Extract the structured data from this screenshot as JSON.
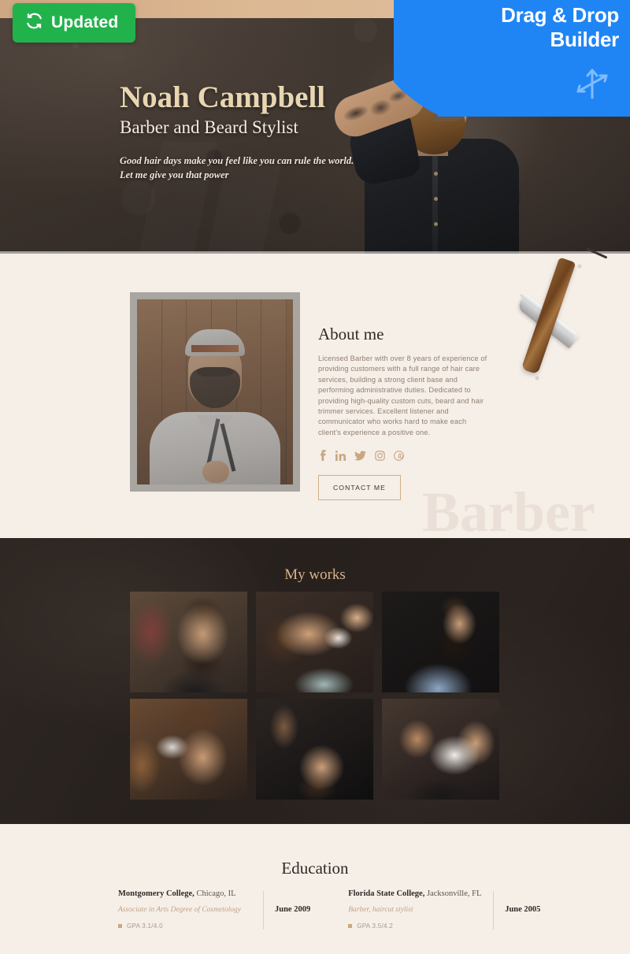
{
  "badges": {
    "updated_label": "Updated",
    "updated_icon": "refresh-sync-icon",
    "updated_color": "#22b24c",
    "ribbon_line1": "Drag & Drop",
    "ribbon_line2": "Builder",
    "ribbon_icon": "move-arrows-icon",
    "ribbon_color": "#1f85f5"
  },
  "hero": {
    "name": "Noah Campbell",
    "subtitle": "Barber and Beard Stylist",
    "tagline": "Good hair days make you feel like you can rule the world. Let me give you that power",
    "name_color": "#e8d6b2"
  },
  "about": {
    "watermark": "Barber",
    "title": "About me",
    "body": "Licensed Barber with over 8 years of experience of providing customers with a full range of hair care services, building a strong client base and performing administrative duties. Dedicated to providing  high-quality custom cuts, beard and hair trimmer services. Excellent listener and communicator who works hard to make each client's experience a positive one.",
    "socials": [
      {
        "name": "facebook-icon",
        "glyph": "f"
      },
      {
        "name": "linkedin-icon",
        "glyph": "in"
      },
      {
        "name": "twitter-icon",
        "glyph": "twitter"
      },
      {
        "name": "instagram-icon",
        "glyph": "instagram"
      },
      {
        "name": "pinterest-icon",
        "glyph": "pinterest"
      }
    ],
    "contact_label": "CONTACT ME",
    "accent_color": "#c8a781",
    "photo_alt": "barber-portrait-with-razor"
  },
  "works": {
    "title": "My works",
    "title_color": "#d8b48a",
    "items": [
      {
        "alt": "barber-trimming-bearded-client"
      },
      {
        "alt": "client-getting-beard-lathered"
      },
      {
        "alt": "bearded-man-in-blue-shirt"
      },
      {
        "alt": "barber-using-clippers-on-client"
      },
      {
        "alt": "straight-razor-shave-closeup"
      },
      {
        "alt": "shaving-cream-applied-to-beard"
      }
    ]
  },
  "education": {
    "title": "Education",
    "entries": [
      {
        "school": "Montgomery College,",
        "city": " Chicago, IL",
        "degree": "Associate in Arts Degree of Cosmetology",
        "gpa": "GPA 3.1/4.0",
        "date": "June 2009"
      },
      {
        "school": "Florida State College,",
        "city": " Jacksonville, FL",
        "degree": "Barber, haircut stylist",
        "gpa": "GPA 3.5/4.2",
        "date": "June 2005"
      }
    ]
  }
}
